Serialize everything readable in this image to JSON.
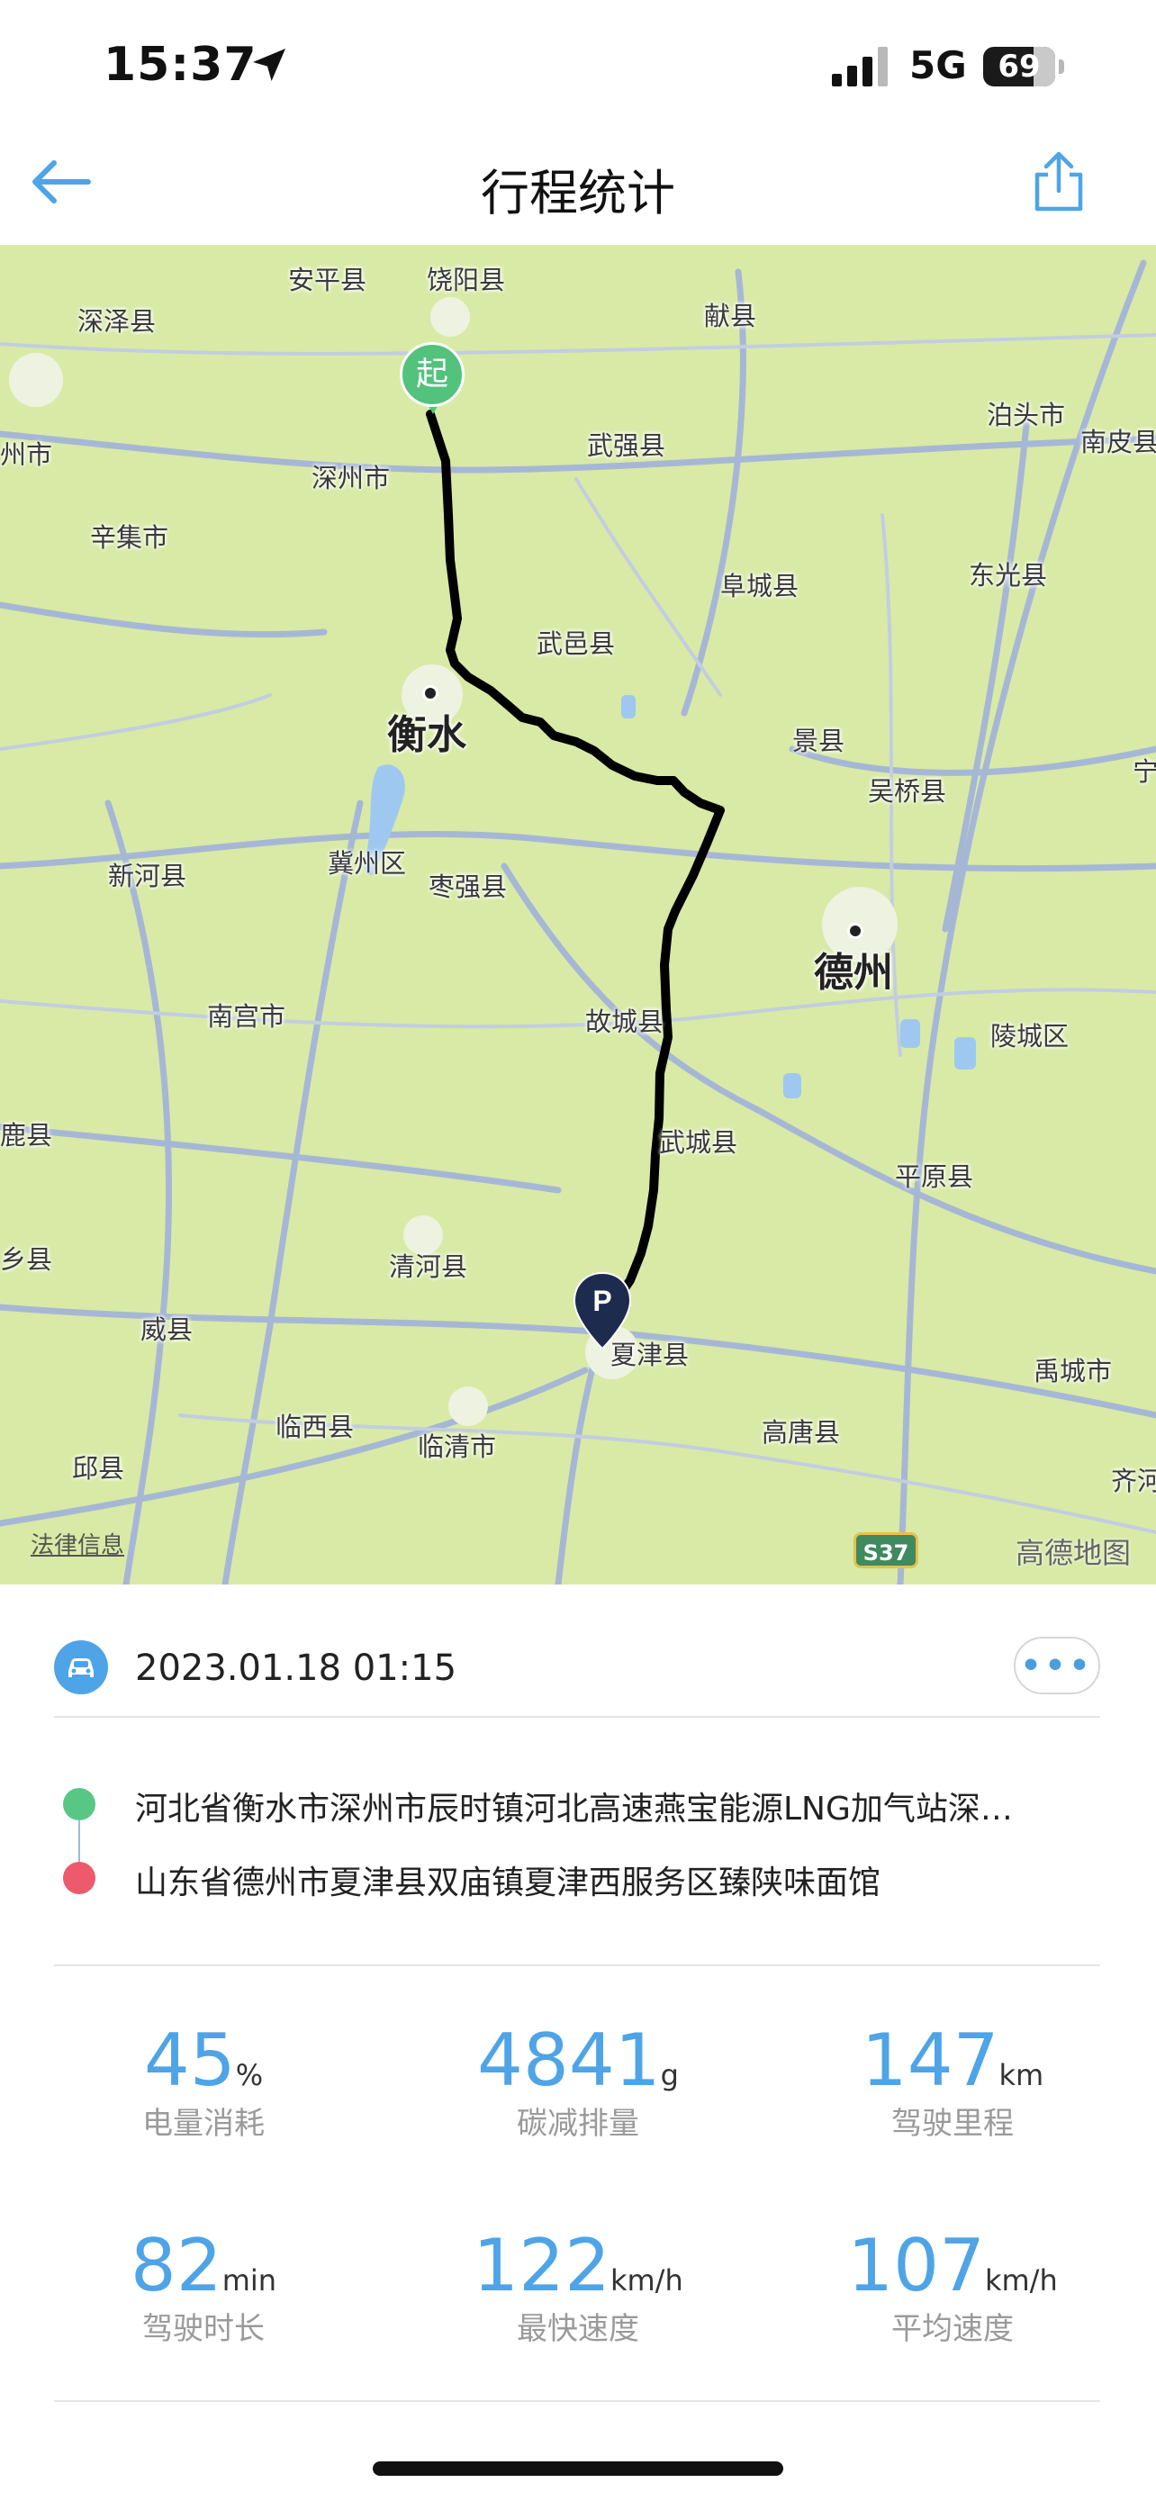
{
  "status_bar": {
    "time": "15:37",
    "network": "5G",
    "battery": "69"
  },
  "nav": {
    "title": "行程统计"
  },
  "map": {
    "start_marker": "起",
    "end_marker": "P",
    "legal_label": "法律信息",
    "road_badge": "S37",
    "brand": "高德地图",
    "labels": {
      "anping": "安平县",
      "raoyang": "饶阳县",
      "xian": "献县",
      "shenze": "深泽县",
      "botou": "泊头市",
      "nanpi": "南皮县",
      "zhoushi": "州市",
      "shenzhou": "深州市",
      "wuqiang": "武强县",
      "xinji": "辛集市",
      "fucheng": "阜城县",
      "dongguang": "东光县",
      "wuyi": "武邑县",
      "hengshui": "衡水",
      "jingxian": "景县",
      "wuqiao": "吴桥县",
      "ning": "宁",
      "xinhe": "新河县",
      "jizhou": "冀州区",
      "zaoqiang": "枣强县",
      "dezhou": "德州",
      "nangong": "南宫市",
      "gucheng": "故城县",
      "lingcheng": "陵城区",
      "luxian": "鹿县",
      "wucheng": "武城县",
      "pingyuan": "平原县",
      "xiang": "乡县",
      "qinghe": "清河县",
      "weixian": "威县",
      "xiajin": "夏津县",
      "yucheng": "禹城市",
      "linxi": "临西县",
      "linqing": "临清市",
      "gaotang": "高唐县",
      "qiuxian": "邱县",
      "qi": "齐河"
    }
  },
  "trip": {
    "datetime": "2023.01.18 01:15",
    "more": "•••",
    "start_address": "河北省衡水市深州市辰时镇河北高速燕宝能源LNG加气站深…",
    "end_address": "山东省德州市夏津县双庙镇夏津西服务区臻陕味面馆"
  },
  "stats": [
    {
      "value": "45",
      "unit": "%",
      "label": "电量消耗"
    },
    {
      "value": "4841",
      "unit": "g",
      "label": "碳减排量"
    },
    {
      "value": "147",
      "unit": "km",
      "label": "驾驶里程"
    },
    {
      "value": "82",
      "unit": "min",
      "label": "驾驶时长"
    },
    {
      "value": "122",
      "unit": "km/h",
      "label": "最快速度"
    },
    {
      "value": "107",
      "unit": "km/h",
      "label": "平均速度"
    }
  ],
  "colors": {
    "accent": "#4ea4e6",
    "start_green": "#58c785",
    "end_red": "#ec5a6b",
    "map_land": "#d8eaa6",
    "route": "#000000",
    "end_pin": "#1d2b4f"
  },
  "icons": [
    "back-arrow-icon",
    "share-icon",
    "location-arrow-icon",
    "car-icon",
    "more-icon"
  ]
}
